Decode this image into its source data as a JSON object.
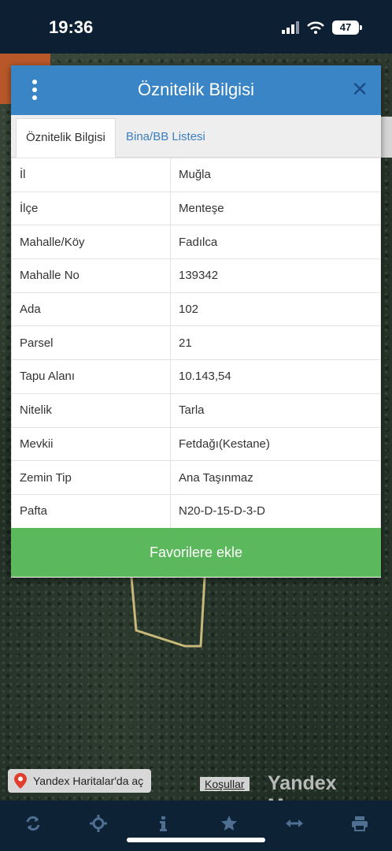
{
  "status": {
    "time": "19:36",
    "battery": "47"
  },
  "modal": {
    "title": "Öznitelik Bilgisi",
    "tabs": [
      {
        "label": "Öznitelik Bilgisi",
        "active": true
      },
      {
        "label": "Bina/BB Listesi",
        "active": false
      }
    ],
    "rows": [
      {
        "key": "İl",
        "value": "Muğla"
      },
      {
        "key": "İlçe",
        "value": "Menteşe"
      },
      {
        "key": "Mahalle/Köy",
        "value": "Fadılca"
      },
      {
        "key": "Mahalle No",
        "value": "139342"
      },
      {
        "key": "Ada",
        "value": "102"
      },
      {
        "key": "Parsel",
        "value": "21"
      },
      {
        "key": "Tapu Alanı",
        "value": "10.143,54"
      },
      {
        "key": "Nitelik",
        "value": "Tarla"
      },
      {
        "key": "Mevkii",
        "value": "Fetdağı(Kestane)"
      },
      {
        "key": "Zemin Tip",
        "value": "Ana Taşınmaz"
      },
      {
        "key": "Pafta",
        "value": "N20-D-15-D-3-D"
      }
    ],
    "favorite_button": "Favorilere ekle"
  },
  "map": {
    "open_in_yandex": "Yandex Haritalar'da aç",
    "terms": "Koşullar",
    "attribution": "Yandex Maps",
    "parcel_color": "#c8b87a"
  },
  "toolbar": {
    "icons": [
      "refresh-icon",
      "locate-icon",
      "info-icon",
      "star-icon",
      "measure-icon",
      "print-icon"
    ]
  },
  "colors": {
    "header": "#3a85c6",
    "button": "#5cb85c",
    "tab_link": "#3a7fc0",
    "toolbar": "#0e2236"
  }
}
